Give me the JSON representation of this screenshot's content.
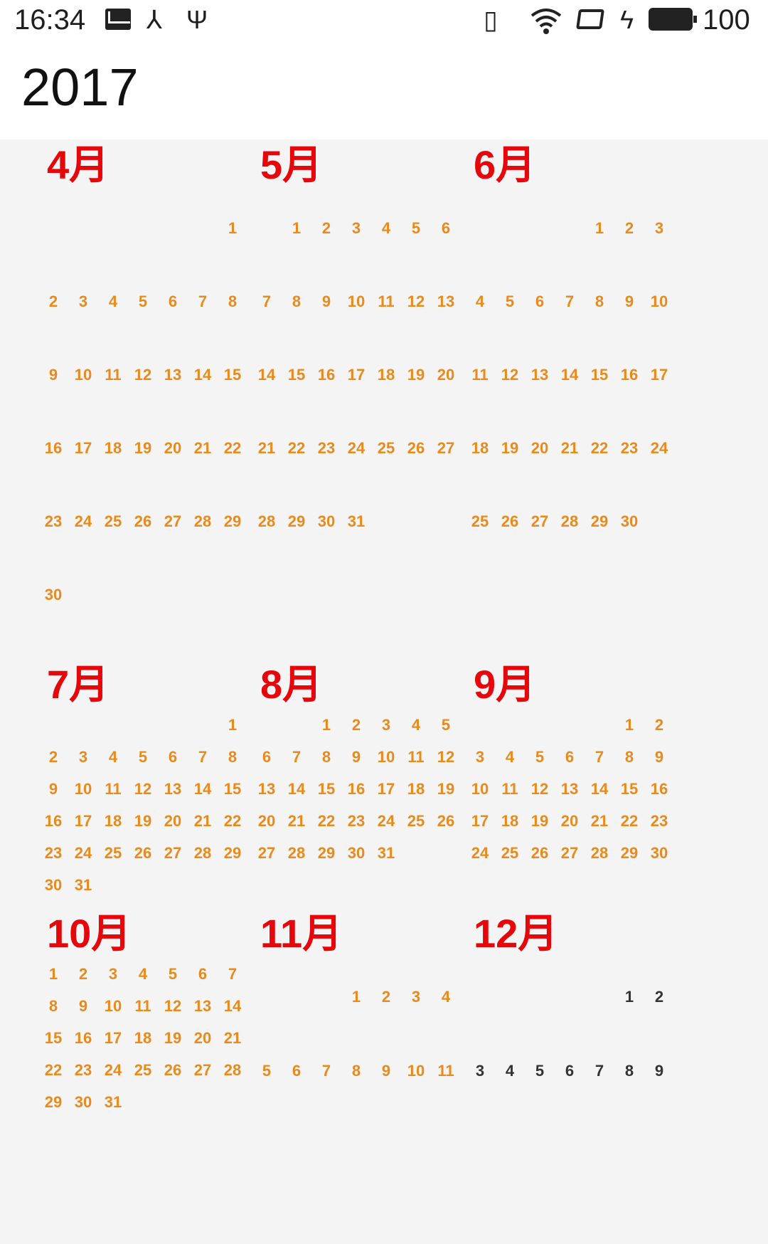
{
  "status_bar": {
    "time": "16:34",
    "battery_level": "100",
    "icons": [
      "mail-icon",
      "usb-icon",
      "usb-debug-icon",
      "vibrate-icon",
      "wifi-icon",
      "rotation-lock-icon",
      "charging-icon",
      "battery-icon"
    ]
  },
  "header": {
    "year": "2017"
  },
  "colors": {
    "month_title": "#e4070b",
    "day_highlight": "#e88a1c",
    "day_plain": "#333333"
  },
  "months": [
    {
      "label": "4月",
      "offset": 6,
      "days": 30,
      "plain": false,
      "layout": "spaced"
    },
    {
      "label": "5月",
      "offset": 1,
      "days": 31,
      "plain": false,
      "layout": "spaced"
    },
    {
      "label": "6月",
      "offset": 4,
      "days": 30,
      "plain": false,
      "layout": "spaced"
    },
    {
      "label": "7月",
      "offset": 6,
      "days": 31,
      "plain": false,
      "layout": "compact"
    },
    {
      "label": "8月",
      "offset": 2,
      "days": 31,
      "plain": false,
      "layout": "compact"
    },
    {
      "label": "9月",
      "offset": 5,
      "days": 30,
      "plain": false,
      "layout": "compact"
    },
    {
      "label": "10月",
      "offset": 0,
      "days": 31,
      "plain": false,
      "layout": "compact"
    },
    {
      "label": "11月",
      "offset": 3,
      "days": 11,
      "plain": false,
      "layout": "spaced"
    },
    {
      "label": "12月",
      "offset": 5,
      "days": 9,
      "plain": true,
      "layout": "spaced"
    }
  ]
}
